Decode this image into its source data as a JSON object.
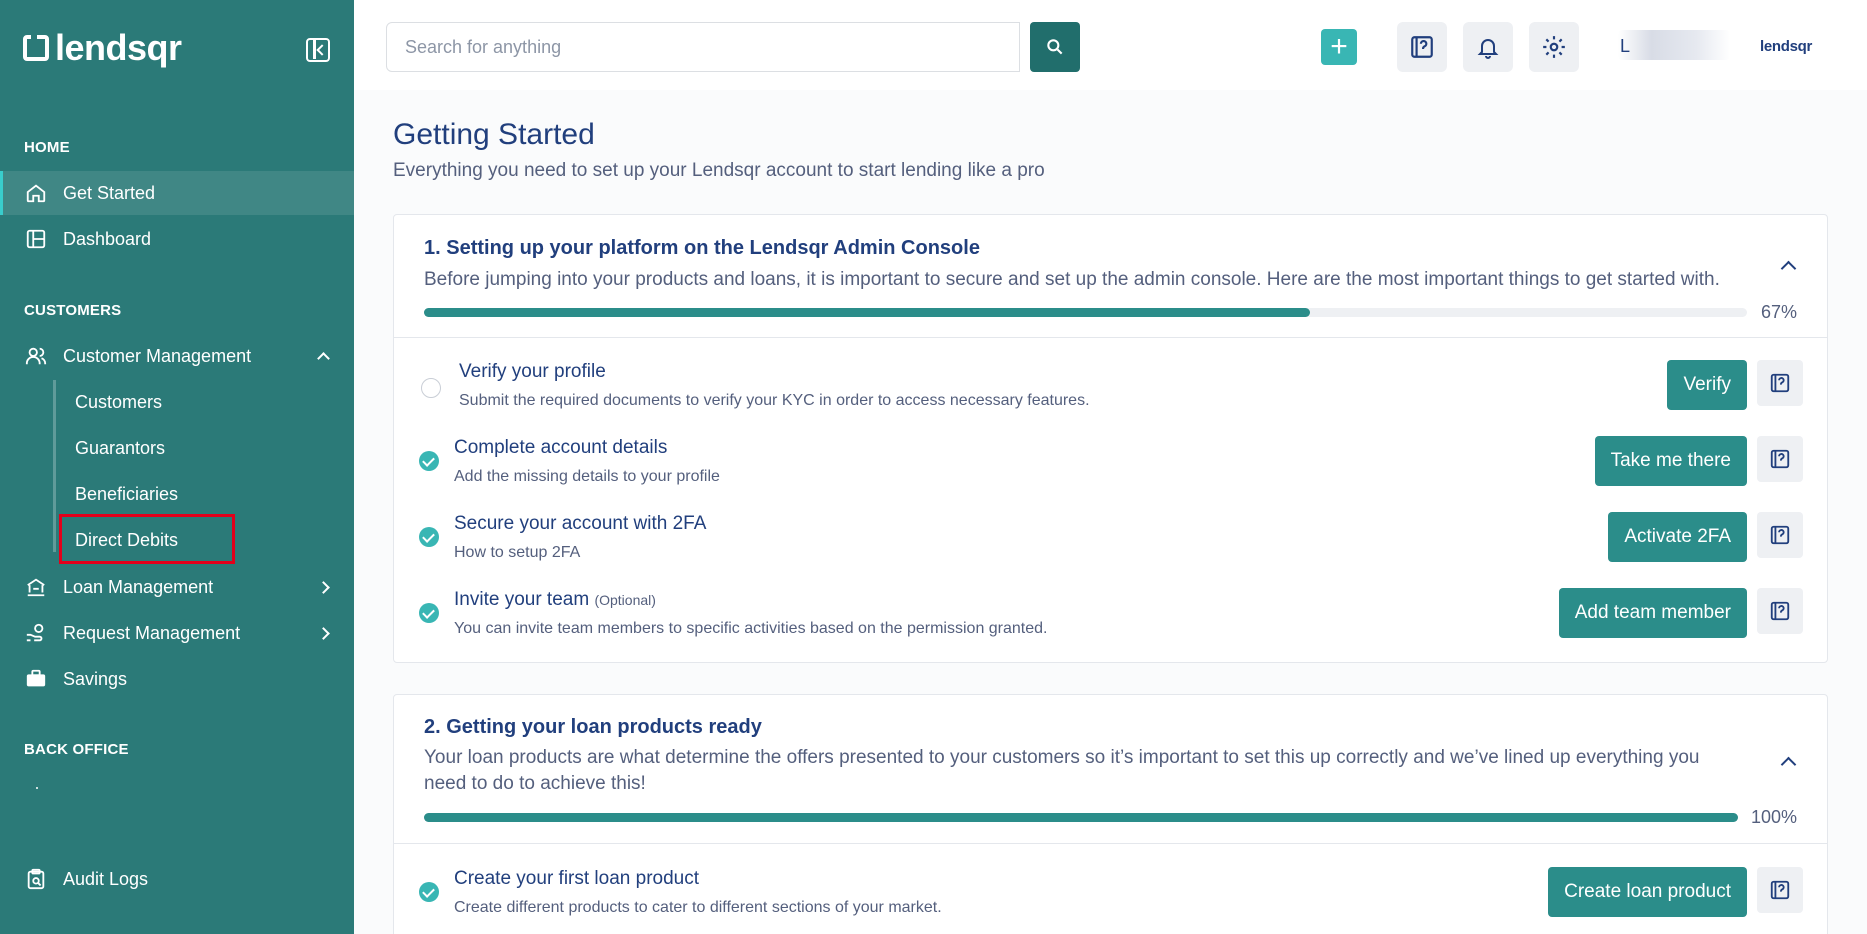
{
  "brand": {
    "name": "lendsqr",
    "small": "lendsqr"
  },
  "sidebar": {
    "sections": [
      {
        "label": "HOME"
      },
      {
        "label": "CUSTOMERS"
      },
      {
        "label": "BACK OFFICE"
      }
    ],
    "items": [
      {
        "label": "Get Started",
        "icon": "home-icon"
      },
      {
        "label": "Dashboard",
        "icon": "dashboard-icon"
      },
      {
        "label": "Customer Management",
        "icon": "users-icon"
      },
      {
        "label": "Loan Management",
        "icon": "bank-icon"
      },
      {
        "label": "Request Management",
        "icon": "hand-money-icon"
      },
      {
        "label": "Savings",
        "icon": "briefcase-icon"
      },
      {
        "label": "Audit Logs",
        "icon": "clipboard-icon"
      }
    ],
    "sub_items": [
      {
        "label": "Customers"
      },
      {
        "label": "Guarantors"
      },
      {
        "label": "Beneficiaries"
      },
      {
        "label": "Direct Debits"
      }
    ]
  },
  "header": {
    "search_placeholder": "Search for anything",
    "avatar_initial": "L"
  },
  "main": {
    "title": "Getting Started",
    "subtitle": "Everything you need to set up your Lendsqr account to start lending like a pro",
    "cards": [
      {
        "title": "1. Setting up your platform on the Lendsqr Admin Console",
        "desc": "Before jumping into your products and loans, it is important to secure and set up the admin console. Here are the most important things to get started with.",
        "progress": 67,
        "progress_label": "67%",
        "tasks": [
          {
            "title": "Verify your profile",
            "optional": "",
            "desc": "Submit the required documents to verify your KYC in order to access necessary features.",
            "button": "Verify",
            "done": false
          },
          {
            "title": "Complete account details",
            "optional": "",
            "desc": "Add the missing details to your profile",
            "button": "Take me there",
            "done": true
          },
          {
            "title": "Secure your account with 2FA",
            "optional": "",
            "desc": "How to setup 2FA",
            "button": "Activate 2FA",
            "done": true
          },
          {
            "title": "Invite your team",
            "optional": "(Optional)",
            "desc": "You can invite team members to specific activities based on the permission granted.",
            "button": "Add team member",
            "done": true
          }
        ]
      },
      {
        "title": "2. Getting your loan products ready",
        "desc": "Your loan products are what determine the offers presented to your customers so it’s important to set this up correctly and we’ve lined up everything you need to do to achieve this!",
        "progress": 100,
        "progress_label": "100%",
        "tasks": [
          {
            "title": "Create your first loan product",
            "optional": "",
            "desc": "Create different products to cater to different sections of your market.",
            "button": "Create loan product",
            "done": true
          }
        ]
      }
    ]
  },
  "colors": {
    "sidebar": "#2b7a78",
    "primary_button": "#2b8d8a",
    "heading": "#213f7d",
    "accent": "#39b6b4"
  }
}
